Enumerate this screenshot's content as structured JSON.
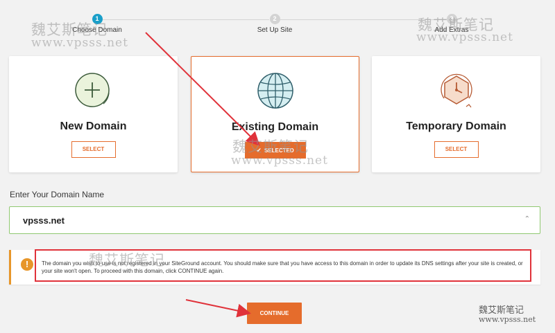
{
  "stepper": {
    "steps": [
      {
        "num": "1",
        "label": "Choose Domain"
      },
      {
        "num": "2",
        "label": "Set Up Site"
      },
      {
        "num": "3",
        "label": "Add Extras"
      }
    ]
  },
  "cards": [
    {
      "title": "New Domain",
      "button": "SELECT"
    },
    {
      "title": "Existing Domain",
      "button": "SELECTED"
    },
    {
      "title": "Temporary Domain",
      "button": "SELECT"
    }
  ],
  "domain": {
    "label": "Enter Your Domain Name",
    "value": "vpsss.net"
  },
  "warning": {
    "text": "The domain you wish to use is not registered in your SiteGround account. You should make sure that you have access to this domain in order to update its DNS settings after your site is created, or your site won't open. To proceed with this domain, click CONTINUE again."
  },
  "continue_label": "CONTINUE",
  "watermark": {
    "cn": "魏艾斯笔记",
    "url": "www.vpsss.net"
  },
  "colors": {
    "accent": "#e56c2c",
    "step_active": "#1a9fc9",
    "warning": "#e7962a",
    "input_border": "#8fc870",
    "annotation_red": "#e0323a"
  }
}
